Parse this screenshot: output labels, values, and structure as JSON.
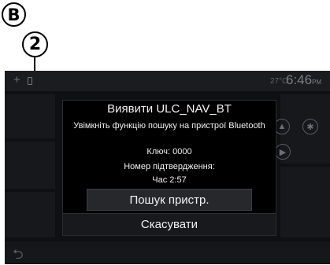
{
  "callouts": {
    "label_b": "B",
    "label_2": "2"
  },
  "statusbar": {
    "plus": "+",
    "temperature": "27°C",
    "time": "6:46",
    "ampm": "PM"
  },
  "dialog": {
    "title": "Виявити ULC_NAV_BT",
    "message": "Увімкніть функцію пошуку на пристрої Bluetooth",
    "key": "Ключ: 0000",
    "confirmation": "Номер підтвердження:",
    "timer": "Час 2:57",
    "search_button": "Пошук пристр.",
    "cancel_button": "Скасувати"
  },
  "icons": {
    "back": "back-arrow-icon",
    "navigation": "navigation-icon",
    "bluetooth": "bluetooth-icon",
    "play": "play-icon"
  },
  "colors": {
    "screen_bg": "#0f1013",
    "dialog_bg": "#000000",
    "text": "#f2f2f2"
  }
}
